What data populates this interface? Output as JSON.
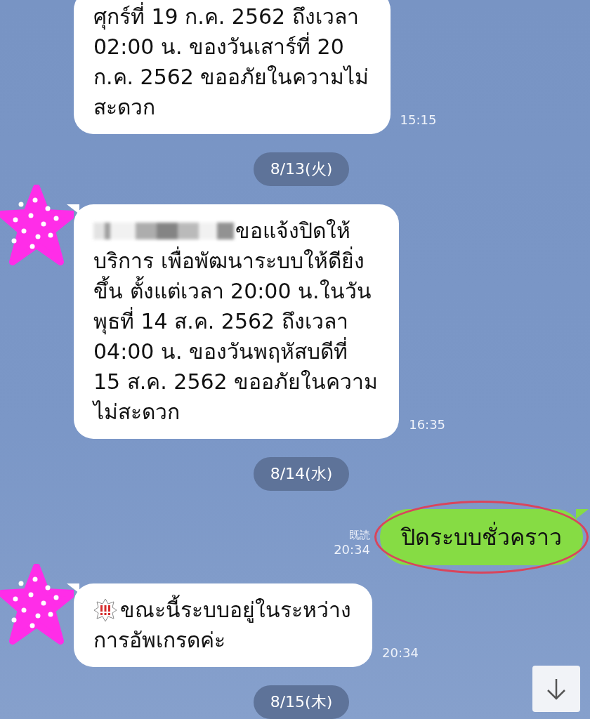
{
  "messages": [
    {
      "kind": "incoming",
      "avatar": false,
      "text": "ศุกร์ที่ 19 ก.ค. 2562 ถึงเวลา\n02:00 น. ของวันเสาร์ที่ 20\nก.ค. 2562 ขออภัยในความไม่\nสะดวก",
      "time": "15:15"
    },
    {
      "kind": "date",
      "text": "8/13(火)"
    },
    {
      "kind": "incoming",
      "avatar": true,
      "redacted": true,
      "lead": "ขอแจ้งปิดให้",
      "text": "บริการ เพื่อพัฒนาระบบให้ดียิ่ง\nขึ้น ตั้งแต่เวลา 20:00 น.ในวัน\nพุธที่ 14 ส.ค. 2562  ถึงเวลา\n04:00 น. ของวันพฤหัสบดีที่\n15 ส.ค. 2562 ขออภัยในความ\nไม่สะดวก",
      "time": "16:35",
      "alert": false
    },
    {
      "kind": "date",
      "text": "8/14(水)"
    },
    {
      "kind": "outgoing",
      "text": "ปิดระบบชั่วคราว",
      "read": "既読",
      "time": "20:34",
      "circled": true
    },
    {
      "kind": "incoming",
      "avatar": true,
      "redacted": false,
      "lead": "ขณะนี้ระบบอยู่ในระหว่าง",
      "text": "การอัพเกรดค่ะ",
      "time": "20:34",
      "alert": true
    },
    {
      "kind": "date",
      "text": "8/15(木)"
    }
  ]
}
